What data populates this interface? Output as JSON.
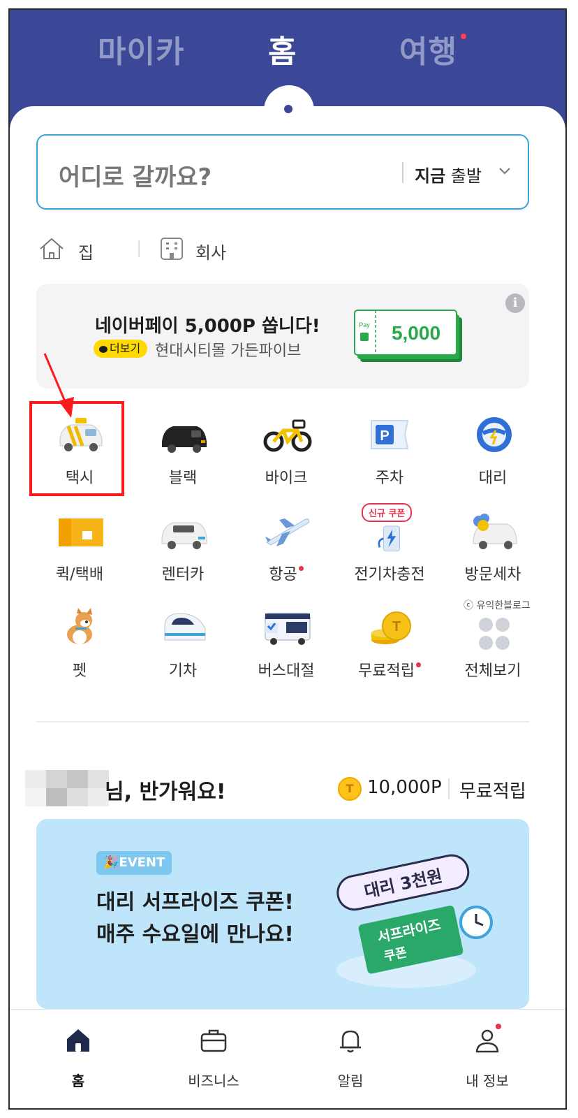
{
  "top_tabs": [
    {
      "label": "마이카",
      "active": false
    },
    {
      "label": "홈",
      "active": true
    },
    {
      "label": "여행",
      "active": false,
      "has_dot": true
    }
  ],
  "search": {
    "placeholder": "어디로 갈까요?",
    "depart_bold": "지금",
    "depart_rest": " 출발"
  },
  "places": [
    {
      "label": "집",
      "icon": "home-icon"
    },
    {
      "label": "회사",
      "icon": "building-icon"
    }
  ],
  "ad": {
    "title": "네이버페이 5,000P 쏩니다!",
    "more_label": "더보기",
    "subtitle": "현대시티몰 가든파이브",
    "ticket_value": "5,000",
    "ticket_small": "Pay",
    "info": "i"
  },
  "services": [
    {
      "label": "택시",
      "icon": "taxi-icon"
    },
    {
      "label": "블랙",
      "icon": "black-car-icon"
    },
    {
      "label": "바이크",
      "icon": "bike-icon"
    },
    {
      "label": "주차",
      "icon": "parking-icon"
    },
    {
      "label": "대리",
      "icon": "steering-wheel-icon"
    },
    {
      "label": "퀵/택배",
      "icon": "parcel-icon"
    },
    {
      "label": "렌터카",
      "icon": "rental-car-icon"
    },
    {
      "label": "항공",
      "icon": "airplane-icon",
      "has_dot": true
    },
    {
      "label": "전기차충전",
      "icon": "ev-charger-icon",
      "badge": "신규 쿠폰"
    },
    {
      "label": "방문세차",
      "icon": "car-wash-icon"
    },
    {
      "label": "펫",
      "icon": "dog-icon"
    },
    {
      "label": "기차",
      "icon": "train-icon"
    },
    {
      "label": "버스대절",
      "icon": "bus-icon"
    },
    {
      "label": "무료적립",
      "icon": "coin-stack-icon",
      "has_dot": true
    },
    {
      "label": "전체보기",
      "icon": "grid-dots-icon"
    }
  ],
  "watermark": "ⓒ 유익한블로그",
  "greeting": {
    "text": "님, 반가워요!",
    "coin_symbol": "T",
    "points": "10,000P",
    "free_label": "무료적립"
  },
  "event": {
    "badge": "🎉EVENT",
    "line1": "대리 서프라이즈 쿠폰!",
    "line2": "매주 수요일에 만나요!",
    "art_text1": "대리 3천원",
    "art_text2": "서프라이즈",
    "art_text3": "쿠폰"
  },
  "bottom_nav": [
    {
      "label": "홈",
      "icon": "home-icon",
      "active": true
    },
    {
      "label": "비즈니스",
      "icon": "briefcase-icon",
      "active": false
    },
    {
      "label": "알림",
      "icon": "bell-icon",
      "active": false
    },
    {
      "label": "내 정보",
      "icon": "person-icon",
      "active": false,
      "has_dot": true
    }
  ],
  "colors": {
    "header": "#3a4897",
    "accent_blue": "#3fa2d8",
    "highlight_red": "#ff1a1a",
    "notification_dot": "#e8314a",
    "event_bg": "#bfe5fb"
  }
}
